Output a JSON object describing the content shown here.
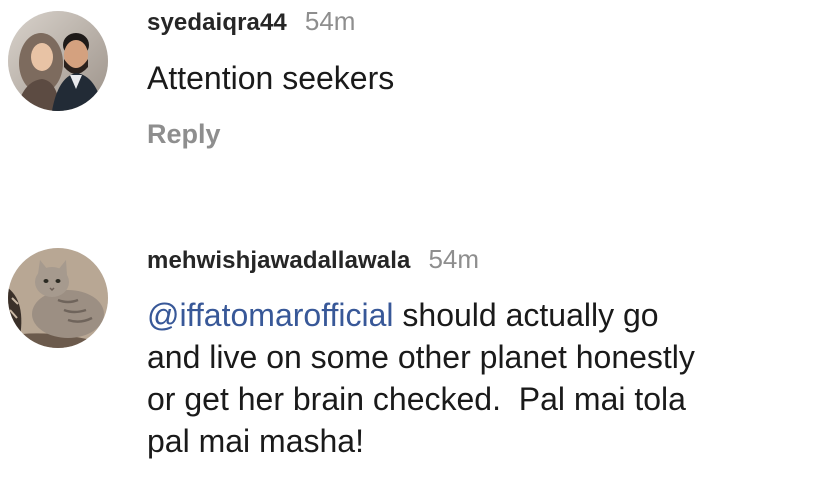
{
  "comments": [
    {
      "username": "syedaiqra44",
      "timestamp": "54m",
      "text": "Attention seekers",
      "reply_label": "Reply",
      "avatar": "avatar-couple-photo"
    },
    {
      "username": "mehwishjawadallawala",
      "timestamp": "54m",
      "mention": "@iffatomarofficial",
      "text_lines": [
        " should actually go",
        "and live on some other planet honestly",
        "or get her brain checked.  Pal mai tola",
        "pal mai masha!"
      ],
      "avatar": "avatar-cat-photo"
    }
  ],
  "colors": {
    "mention": "#385898",
    "muted": "#8e8e8e",
    "text": "#1a1a1a"
  }
}
